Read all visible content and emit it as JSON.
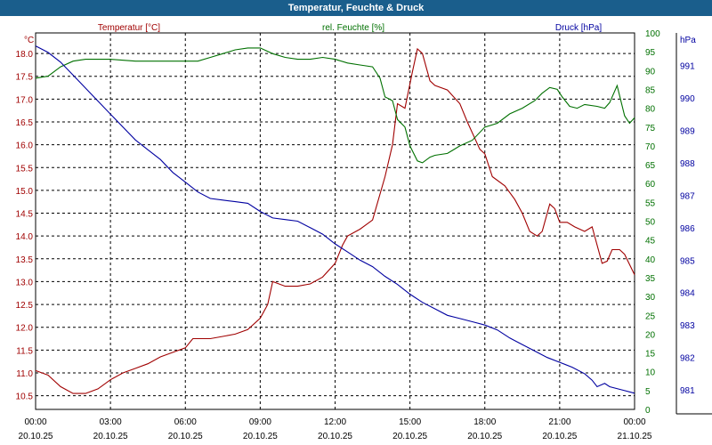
{
  "title": "Temperatur, Feuchte & Druck",
  "colors": {
    "titlebar_bg": "#1a5e8c",
    "plot_bg": "#ffffff",
    "temperature": "#a00000",
    "humidity": "#007000",
    "pressure": "#0000a0",
    "grid": "#000000"
  },
  "chart_data": {
    "type": "line",
    "title": "Temperatur, Feuchte & Druck",
    "grid": true,
    "x_range": [
      "20.10.25 00:00",
      "21.10.25 00:00"
    ],
    "x_ticks": [
      {
        "time": "00:00",
        "date": "20.10.25"
      },
      {
        "time": "03:00",
        "date": "20.10.25"
      },
      {
        "time": "06:00",
        "date": "20.10.25"
      },
      {
        "time": "09:00",
        "date": "20.10.25"
      },
      {
        "time": "12:00",
        "date": "20.10.25"
      },
      {
        "time": "15:00",
        "date": "20.10.25"
      },
      {
        "time": "18:00",
        "date": "20.10.25"
      },
      {
        "time": "21:00",
        "date": "20.10.25"
      },
      {
        "time": "00:00",
        "date": "21.10.25"
      }
    ],
    "axes": {
      "temperature": {
        "unit": "°C",
        "label": "Temperatur [°C]",
        "range": [
          10.2,
          18.45
        ],
        "ticks": [
          "18.0",
          "17.5",
          "17.0",
          "16.5",
          "16.0",
          "15.5",
          "15.0",
          "14.5",
          "14.0",
          "13.5",
          "13.0",
          "12.5",
          "12.0",
          "11.5",
          "11.0",
          "10.5"
        ]
      },
      "humidity": {
        "unit": "%",
        "label": "rel. Feuchte [%]",
        "range": [
          0,
          100
        ],
        "ticks": [
          "100",
          "95",
          "90",
          "85",
          "80",
          "75",
          "70",
          "65",
          "60",
          "55",
          "50",
          "45",
          "40",
          "35",
          "30",
          "25",
          "20",
          "15",
          "10",
          "5",
          "0"
        ]
      },
      "pressure": {
        "unit": "hPa",
        "label": "Druck [hPa]",
        "range": [
          980.4,
          992.0
        ],
        "ticks": [
          "991",
          "990",
          "989",
          "988",
          "987",
          "986",
          "985",
          "984",
          "983",
          "982",
          "981"
        ]
      }
    },
    "series": [
      {
        "name": "Temperatur [°C]",
        "axis": "temperature",
        "points": [
          [
            0,
            11.05
          ],
          [
            0.5,
            10.95
          ],
          [
            1,
            10.7
          ],
          [
            1.5,
            10.55
          ],
          [
            2,
            10.55
          ],
          [
            2.5,
            10.65
          ],
          [
            3,
            10.85
          ],
          [
            3.5,
            11.0
          ],
          [
            4,
            11.1
          ],
          [
            4.5,
            11.2
          ],
          [
            5,
            11.35
          ],
          [
            5.5,
            11.45
          ],
          [
            6,
            11.55
          ],
          [
            6.3,
            11.75
          ],
          [
            7,
            11.75
          ],
          [
            7.5,
            11.8
          ],
          [
            8,
            11.85
          ],
          [
            8.5,
            11.95
          ],
          [
            9,
            12.2
          ],
          [
            9.3,
            12.5
          ],
          [
            9.5,
            13.0
          ],
          [
            10,
            12.9
          ],
          [
            10.5,
            12.9
          ],
          [
            11,
            12.95
          ],
          [
            11.5,
            13.1
          ],
          [
            12,
            13.4
          ],
          [
            12.3,
            13.8
          ],
          [
            12.5,
            14.0
          ],
          [
            13,
            14.15
          ],
          [
            13.5,
            14.35
          ],
          [
            14,
            15.3
          ],
          [
            14.3,
            16.0
          ],
          [
            14.5,
            16.9
          ],
          [
            14.8,
            16.8
          ],
          [
            15.1,
            17.6
          ],
          [
            15.3,
            18.1
          ],
          [
            15.5,
            18.0
          ],
          [
            15.8,
            17.4
          ],
          [
            16,
            17.3
          ],
          [
            16.5,
            17.2
          ],
          [
            17,
            16.9
          ],
          [
            17.3,
            16.5
          ],
          [
            17.8,
            15.9
          ],
          [
            18,
            15.8
          ],
          [
            18.3,
            15.3
          ],
          [
            18.8,
            15.1
          ],
          [
            19.2,
            14.8
          ],
          [
            19.5,
            14.5
          ],
          [
            19.8,
            14.1
          ],
          [
            20.1,
            14.0
          ],
          [
            20.3,
            14.1
          ],
          [
            20.6,
            14.7
          ],
          [
            20.8,
            14.6
          ],
          [
            21,
            14.3
          ],
          [
            21.3,
            14.3
          ],
          [
            21.6,
            14.2
          ],
          [
            22,
            14.1
          ],
          [
            22.3,
            14.2
          ],
          [
            22.7,
            13.4
          ],
          [
            22.9,
            13.45
          ],
          [
            23.1,
            13.7
          ],
          [
            23.4,
            13.7
          ],
          [
            23.6,
            13.6
          ],
          [
            24,
            13.15
          ]
        ]
      },
      {
        "name": "rel. Feuchte [%]",
        "axis": "humidity",
        "points": [
          [
            0,
            88
          ],
          [
            0.5,
            88.5
          ],
          [
            1,
            91
          ],
          [
            1.5,
            92.5
          ],
          [
            2,
            93
          ],
          [
            3,
            93
          ],
          [
            4,
            92.5
          ],
          [
            5,
            92.5
          ],
          [
            6,
            92.5
          ],
          [
            6.5,
            92.5
          ],
          [
            7,
            93.5
          ],
          [
            7.5,
            94.5
          ],
          [
            8,
            95.5
          ],
          [
            8.5,
            96
          ],
          [
            9,
            96
          ],
          [
            9.5,
            94.5
          ],
          [
            10,
            93.5
          ],
          [
            10.5,
            93
          ],
          [
            11,
            93
          ],
          [
            11.5,
            93.5
          ],
          [
            12,
            93
          ],
          [
            12.5,
            92
          ],
          [
            13,
            91.5
          ],
          [
            13.5,
            91
          ],
          [
            13.8,
            88
          ],
          [
            14,
            83
          ],
          [
            14.3,
            82
          ],
          [
            14.5,
            77
          ],
          [
            14.8,
            75
          ],
          [
            15,
            70
          ],
          [
            15.3,
            66
          ],
          [
            15.5,
            65.5
          ],
          [
            15.8,
            67
          ],
          [
            16,
            67.5
          ],
          [
            16.5,
            68
          ],
          [
            17,
            70
          ],
          [
            17.5,
            71.5
          ],
          [
            18,
            75
          ],
          [
            18.5,
            76
          ],
          [
            19,
            78.5
          ],
          [
            19.5,
            80
          ],
          [
            20,
            82
          ],
          [
            20.3,
            84
          ],
          [
            20.6,
            85.5
          ],
          [
            20.9,
            85
          ],
          [
            21.1,
            83
          ],
          [
            21.4,
            80.5
          ],
          [
            21.7,
            80
          ],
          [
            22,
            81
          ],
          [
            22.5,
            80.5
          ],
          [
            22.8,
            80
          ],
          [
            23,
            81.5
          ],
          [
            23.3,
            86
          ],
          [
            23.6,
            78
          ],
          [
            23.8,
            76
          ],
          [
            24,
            77.5
          ]
        ]
      },
      {
        "name": "Druck [hPa]",
        "axis": "pressure",
        "points": [
          [
            0,
            991.6
          ],
          [
            0.5,
            991.4
          ],
          [
            1,
            991.1
          ],
          [
            1.5,
            990.7
          ],
          [
            2,
            990.3
          ],
          [
            2.5,
            989.9
          ],
          [
            3,
            989.5
          ],
          [
            3.5,
            989.1
          ],
          [
            4,
            988.7
          ],
          [
            4.5,
            988.4
          ],
          [
            5,
            988.1
          ],
          [
            5.5,
            987.7
          ],
          [
            6,
            987.4
          ],
          [
            6.5,
            987.1
          ],
          [
            7,
            986.9
          ],
          [
            7.5,
            986.85
          ],
          [
            8,
            986.8
          ],
          [
            8.5,
            986.75
          ],
          [
            9,
            986.5
          ],
          [
            9.5,
            986.3
          ],
          [
            10,
            986.25
          ],
          [
            10.5,
            986.2
          ],
          [
            11,
            986.0
          ],
          [
            11.5,
            985.8
          ],
          [
            12,
            985.5
          ],
          [
            12.5,
            985.25
          ],
          [
            13,
            985.0
          ],
          [
            13.5,
            984.8
          ],
          [
            14,
            984.5
          ],
          [
            14.5,
            984.25
          ],
          [
            15,
            983.95
          ],
          [
            15.5,
            983.7
          ],
          [
            16,
            983.5
          ],
          [
            16.5,
            983.3
          ],
          [
            17,
            983.2
          ],
          [
            17.5,
            983.1
          ],
          [
            18,
            983.0
          ],
          [
            18.5,
            982.85
          ],
          [
            19,
            982.6
          ],
          [
            19.5,
            982.4
          ],
          [
            20,
            982.2
          ],
          [
            20.5,
            982.0
          ],
          [
            21,
            981.85
          ],
          [
            21.5,
            981.7
          ],
          [
            22,
            981.5
          ],
          [
            22.3,
            981.3
          ],
          [
            22.5,
            981.1
          ],
          [
            22.8,
            981.2
          ],
          [
            23,
            981.1
          ],
          [
            23.5,
            981.0
          ],
          [
            24,
            980.9
          ]
        ]
      }
    ]
  }
}
